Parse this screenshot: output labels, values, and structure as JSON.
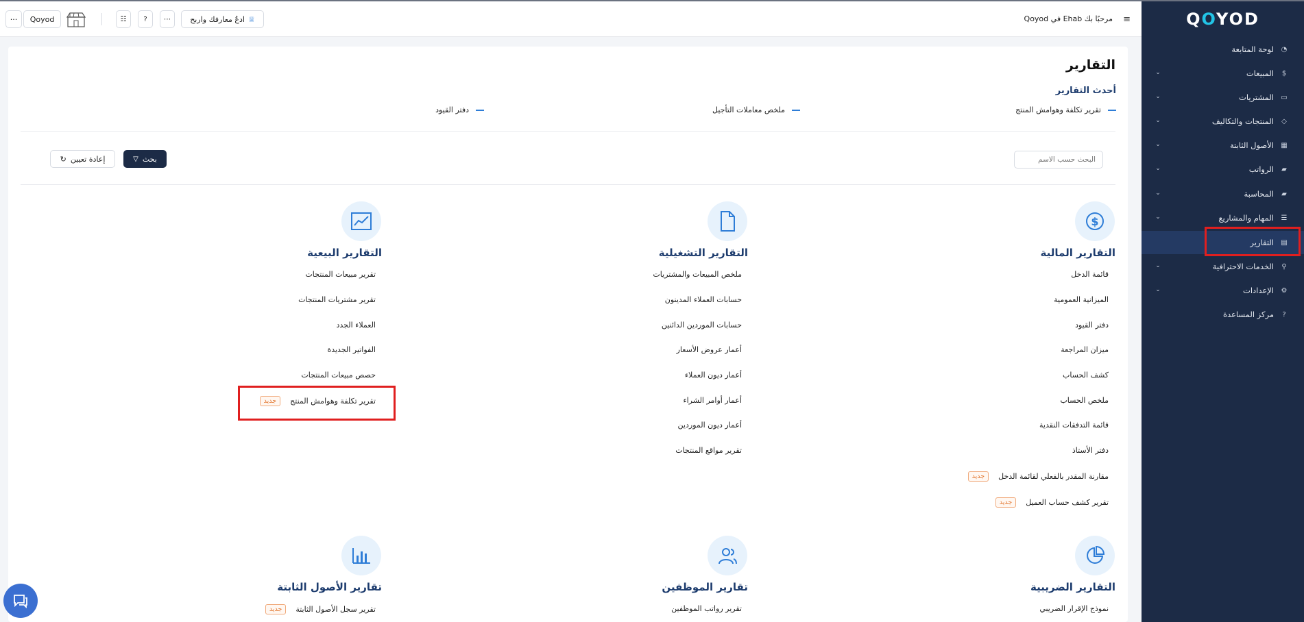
{
  "sidebar": {
    "logo_main": "QOYOD",
    "items": [
      {
        "label": "لوحة المتابعة",
        "icon": "gauge-icon",
        "chevron": false
      },
      {
        "label": "المبيعات",
        "icon": "dollar-icon",
        "chevron": true
      },
      {
        "label": "المشتريات",
        "icon": "clipboard-icon",
        "chevron": true
      },
      {
        "label": "المنتجات والتكاليف",
        "icon": "box-icon",
        "chevron": true
      },
      {
        "label": "الأصول الثابتة",
        "icon": "grid-icon",
        "chevron": true
      },
      {
        "label": "الرواتب",
        "icon": "folder-icon",
        "chevron": true
      },
      {
        "label": "المحاسبة",
        "icon": "folder-icon",
        "chevron": true
      },
      {
        "label": "المهام والمشاريع",
        "icon": "list-icon",
        "chevron": true
      },
      {
        "label": "التقارير",
        "icon": "report-icon",
        "chevron": false,
        "active": true
      },
      {
        "label": "الخدمات الاحترافية",
        "icon": "search-icon",
        "chevron": true
      },
      {
        "label": "الإعدادات",
        "icon": "gear-icon",
        "chevron": true
      },
      {
        "label": "مركز المساعدة",
        "icon": "help-icon",
        "chevron": false
      }
    ]
  },
  "header": {
    "welcome": "مرحبًا بك Ehab في Qoyod",
    "invite_label": "ادعُ معارفك واربح",
    "company": "Qoyod",
    "more": "···"
  },
  "main": {
    "title": "التقارير",
    "recent_title": "أحدث التقارير",
    "recent": [
      "تقرير تكلفة وهوامش المنتج",
      "ملخص معاملات التأجيل",
      "دفتر القيود"
    ],
    "search_placeholder": "البحث حسب الاسم",
    "search_button": "بحث",
    "reset_button": "إعادة تعيين",
    "new_badge": "جديد",
    "categories": [
      {
        "title": "التقارير المالية",
        "icon": "dollar-circle-icon",
        "reports": [
          {
            "label": "قائمة الدخل"
          },
          {
            "label": "الميزانية العمومية"
          },
          {
            "label": "دفتر القيود"
          },
          {
            "label": "ميزان المراجعة"
          },
          {
            "label": "كشف الحساب"
          },
          {
            "label": "ملخص الحساب"
          },
          {
            "label": "قائمة التدفقات النقدية"
          },
          {
            "label": "دفتر الأستاذ"
          },
          {
            "label": "مقارنة المقدر بالفعلي لقائمة الدخل",
            "new": true
          },
          {
            "label": "تقرير كشف حساب العميل",
            "new": true
          }
        ]
      },
      {
        "title": "التقارير التشغيلية",
        "icon": "document-icon",
        "reports": [
          {
            "label": "ملخص المبيعات والمشتريات"
          },
          {
            "label": "حسابات العملاء المدينون"
          },
          {
            "label": "حسابات الموردين الدائنين"
          },
          {
            "label": "أعمار عروض الأسعار"
          },
          {
            "label": "أعمار ديون العملاء"
          },
          {
            "label": "أعمار أوامر الشراء"
          },
          {
            "label": "أعمار ديون الموردين"
          },
          {
            "label": "تقرير مواقع المنتجات"
          }
        ]
      },
      {
        "title": "التقارير البيعية",
        "icon": "trend-chart-icon",
        "reports": [
          {
            "label": "تقرير مبيعات المنتجات"
          },
          {
            "label": "تقرير مشتريات المنتجات"
          },
          {
            "label": "العملاء الجدد"
          },
          {
            "label": "الفواتير الجديدة"
          },
          {
            "label": "حصص مبيعات المنتجات"
          },
          {
            "label": "تقرير تكلفة وهوامش المنتج",
            "new": true
          }
        ]
      },
      {
        "title": "التقارير الضريبية",
        "icon": "pie-chart-icon",
        "reports": [
          {
            "label": "نموذج الإقرار الضريبي"
          }
        ]
      },
      {
        "title": "تقارير الموظفين",
        "icon": "users-icon",
        "reports": [
          {
            "label": "تقرير رواتب الموظفين"
          }
        ]
      },
      {
        "title": "تقارير الأصول الثابتة",
        "icon": "bar-chart-icon",
        "reports": [
          {
            "label": "تقرير سجل الأصول الثابتة",
            "new": true
          }
        ]
      }
    ]
  },
  "colors": {
    "sidebar_bg": "#1c2b46",
    "accent_blue": "#1d3c6e",
    "highlight_red": "#e01f1f",
    "badge_orange": "#e37a35"
  }
}
